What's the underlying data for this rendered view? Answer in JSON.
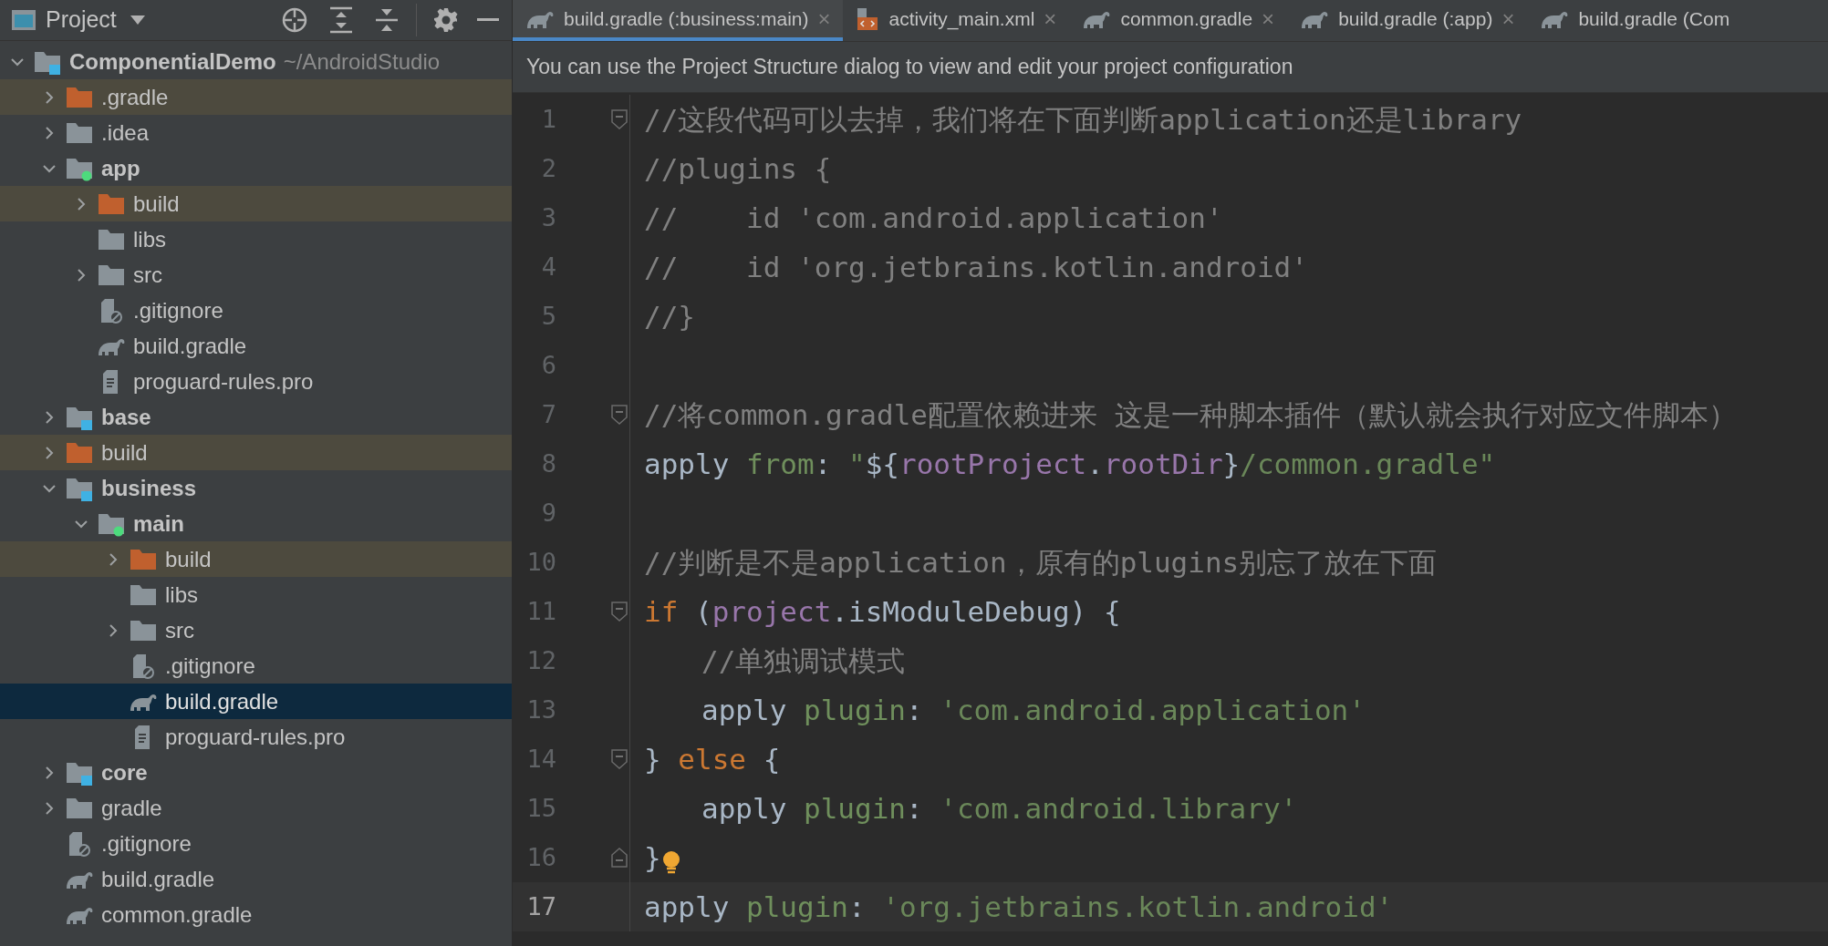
{
  "toolbar": {
    "title": "Project"
  },
  "tree": [
    {
      "label": "ComponentialDemo",
      "path": "~/AndroidStudio",
      "kind": "module",
      "expanded": true,
      "selected": false,
      "children": [
        {
          "label": ".gradle",
          "kind": "excluded",
          "expanded": false,
          "selected": false
        },
        {
          "label": ".idea",
          "kind": "folder",
          "expanded": false,
          "selected": false
        },
        {
          "label": "app",
          "kind": "source_module",
          "expanded": true,
          "selected": false,
          "children": [
            {
              "label": "build",
              "kind": "excluded",
              "expanded": false,
              "selected": false
            },
            {
              "label": "libs",
              "kind": "folder",
              "selected": false
            },
            {
              "label": "src",
              "kind": "folder",
              "expanded": false,
              "selected": false
            },
            {
              "label": ".gitignore",
              "kind": "ignore",
              "selected": false
            },
            {
              "label": "build.gradle",
              "kind": "gradle",
              "selected": false
            },
            {
              "label": "proguard-rules.pro",
              "kind": "text",
              "selected": false
            }
          ]
        },
        {
          "label": "base",
          "kind": "module",
          "expanded": false,
          "selected": false
        },
        {
          "label": "build",
          "kind": "excluded",
          "expanded": false,
          "selected": false
        },
        {
          "label": "business",
          "kind": "module",
          "expanded": true,
          "selected": false,
          "children": [
            {
              "label": "main",
              "kind": "source_module",
              "expanded": true,
              "selected": false,
              "children": [
                {
                  "label": "build",
                  "kind": "excluded",
                  "expanded": false,
                  "selected": false
                },
                {
                  "label": "libs",
                  "kind": "folder",
                  "selected": false
                },
                {
                  "label": "src",
                  "kind": "folder",
                  "expanded": false,
                  "selected": false
                },
                {
                  "label": ".gitignore",
                  "kind": "ignore",
                  "selected": false
                },
                {
                  "label": "build.gradle",
                  "kind": "gradle",
                  "selected": true
                },
                {
                  "label": "proguard-rules.pro",
                  "kind": "text",
                  "selected": false
                }
              ]
            }
          ]
        },
        {
          "label": "core",
          "kind": "module",
          "expanded": false,
          "selected": false
        },
        {
          "label": "gradle",
          "kind": "folder",
          "expanded": false,
          "selected": false
        },
        {
          "label": ".gitignore",
          "kind": "ignore",
          "selected": false
        },
        {
          "label": "build.gradle",
          "kind": "gradle",
          "selected": false
        },
        {
          "label": "common.gradle",
          "kind": "gradle",
          "selected": false
        }
      ]
    }
  ],
  "tabs": [
    {
      "label": "build.gradle (:business:main)",
      "kind": "gradle",
      "selected": true,
      "close": "×"
    },
    {
      "label": "activity_main.xml",
      "kind": "xml",
      "selected": false,
      "close": "×"
    },
    {
      "label": "common.gradle",
      "kind": "gradle",
      "selected": false,
      "close": "×"
    },
    {
      "label": "build.gradle (:app)",
      "kind": "gradle",
      "selected": false,
      "close": "×"
    },
    {
      "label": "build.gradle (Com",
      "kind": "gradle",
      "selected": false
    }
  ],
  "banner": "You can use the Project Structure dialog to view and edit your project configuration",
  "editor": {
    "lines": [
      {
        "number": "1",
        "fold": {
          "kind": "start"
        },
        "segments": [
          {
            "kind": "comment",
            "text": "//这段代码可以去掉，我们将在下面判断application还是library"
          }
        ]
      },
      {
        "number": "2",
        "segments": [
          {
            "kind": "comment",
            "text": "//plugins {"
          }
        ]
      },
      {
        "number": "3",
        "segments": [
          {
            "kind": "comment",
            "text": "//    id 'com.android.application'"
          }
        ]
      },
      {
        "number": "4",
        "segments": [
          {
            "kind": "comment",
            "text": "//    id 'org.jetbrains.kotlin.android'"
          }
        ]
      },
      {
        "number": "5",
        "segments": [
          {
            "kind": "comment",
            "text": "//}"
          }
        ]
      },
      {
        "number": "6"
      },
      {
        "number": "7",
        "fold": {
          "kind": "start"
        },
        "segments": [
          {
            "kind": "comment",
            "text": "//将common.gradle配置依赖进来 这是一种脚本插件（默认就会执行对应文件脚本）"
          }
        ]
      },
      {
        "number": "8",
        "segments": [
          {
            "kind": "plain",
            "text": "apply "
          },
          {
            "kind": "arg",
            "text": "from"
          },
          {
            "kind": "plain",
            "text": ": "
          },
          {
            "kind": "string",
            "text": "\""
          },
          {
            "kind": "plain",
            "text": "${"
          },
          {
            "kind": "field",
            "text": "rootProject"
          },
          {
            "kind": "plain",
            "text": "."
          },
          {
            "kind": "field",
            "text": "rootDir"
          },
          {
            "kind": "plain",
            "text": "}"
          },
          {
            "kind": "string",
            "text": "/common.gradle\""
          }
        ]
      },
      {
        "number": "9"
      },
      {
        "number": "10",
        "segments": [
          {
            "kind": "comment",
            "text": "//判断是不是application，原有的plugins别忘了放在下面"
          }
        ]
      },
      {
        "number": "11",
        "fold": {
          "kind": "start"
        },
        "segments": [
          {
            "kind": "keyword",
            "text": "if"
          },
          {
            "kind": "plain",
            "text": " ("
          },
          {
            "kind": "field",
            "text": "project"
          },
          {
            "kind": "plain",
            "text": ".isModuleDebug) {"
          }
        ]
      },
      {
        "number": "12",
        "indented": true,
        "segments": [
          {
            "kind": "comment",
            "text": "//单独调试模式"
          }
        ]
      },
      {
        "number": "13",
        "indented": true,
        "segments": [
          {
            "kind": "plain",
            "text": "apply "
          },
          {
            "kind": "arg",
            "text": "plugin"
          },
          {
            "kind": "plain",
            "text": ": "
          },
          {
            "kind": "string",
            "text": "'com.android.application'"
          }
        ]
      },
      {
        "number": "14",
        "fold": {
          "kind": "start"
        },
        "segments": [
          {
            "kind": "plain",
            "text": "} "
          },
          {
            "kind": "keyword",
            "text": "else"
          },
          {
            "kind": "plain",
            "text": " {"
          }
        ]
      },
      {
        "number": "15",
        "indented": true,
        "segments": [
          {
            "kind": "plain",
            "text": "apply "
          },
          {
            "kind": "arg",
            "text": "plugin"
          },
          {
            "kind": "plain",
            "text": ": "
          },
          {
            "kind": "string",
            "text": "'com.android.library'"
          }
        ]
      },
      {
        "number": "16",
        "fold": {
          "kind": "end"
        },
        "bulb": true,
        "segments": [
          {
            "kind": "plain",
            "text": "}"
          }
        ]
      },
      {
        "number": "17",
        "current": true,
        "segments": [
          {
            "kind": "plain",
            "text": "apply "
          },
          {
            "kind": "arg",
            "text": "plugin"
          },
          {
            "kind": "plain",
            "text": ": "
          },
          {
            "kind": "string",
            "text": "'org.jetbrains.kotlin.android'"
          }
        ]
      }
    ]
  }
}
